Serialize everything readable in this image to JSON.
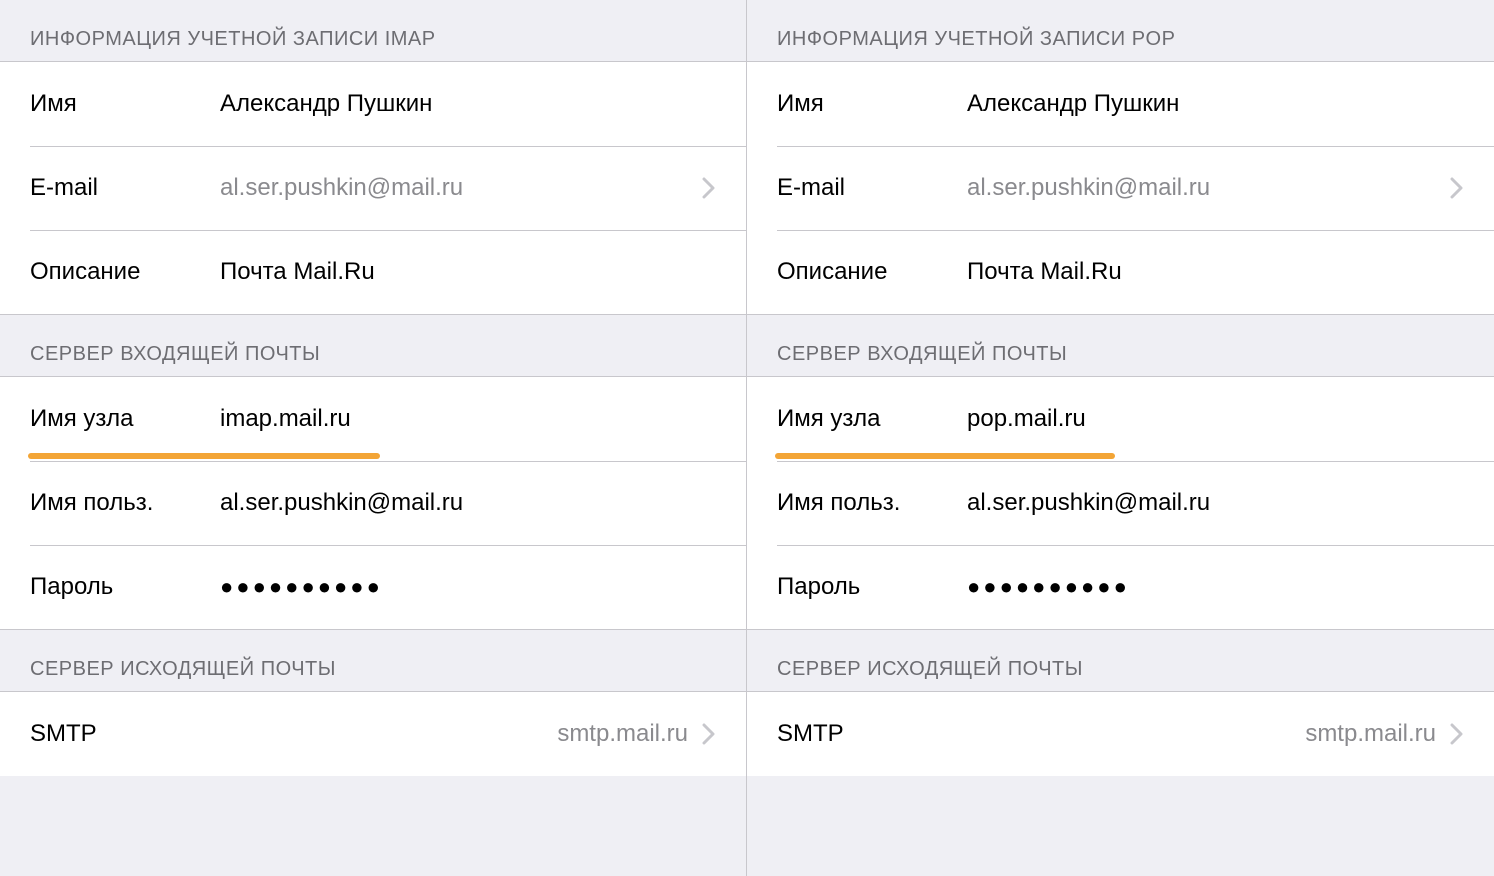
{
  "left": {
    "account_header": "ИНФОРМАЦИЯ УЧЕТНОЙ ЗАПИСИ IMAP",
    "rows": {
      "name_label": "Имя",
      "name_value": "Александр Пушкин",
      "email_label": "E-mail",
      "email_value": "al.ser.pushkin@mail.ru",
      "desc_label": "Описание",
      "desc_value": "Почта Mail.Ru"
    },
    "incoming_header": "СЕРВЕР ВХОДЯЩЕЙ ПОЧТЫ",
    "incoming": {
      "host_label": "Имя узла",
      "host_value": "imap.mail.ru",
      "user_label": "Имя польз.",
      "user_value": "al.ser.pushkin@mail.ru",
      "pass_label": "Пароль",
      "pass_value": "●●●●●●●●●●"
    },
    "outgoing_header": "СЕРВЕР ИСХОДЯЩЕЙ ПОЧТЫ",
    "outgoing": {
      "smtp_label": "SMTP",
      "smtp_value": "smtp.mail.ru"
    },
    "underline_width": 352
  },
  "right": {
    "account_header": "ИНФОРМАЦИЯ УЧЕТНОЙ ЗАПИСИ POP",
    "rows": {
      "name_label": "Имя",
      "name_value": "Александр Пушкин",
      "email_label": "E-mail",
      "email_value": "al.ser.pushkin@mail.ru",
      "desc_label": "Описание",
      "desc_value": "Почта Mail.Ru"
    },
    "incoming_header": "СЕРВЕР ВХОДЯЩЕЙ ПОЧТЫ",
    "incoming": {
      "host_label": "Имя узла",
      "host_value": "pop.mail.ru",
      "user_label": "Имя польз.",
      "user_value": "al.ser.pushkin@mail.ru",
      "pass_label": "Пароль",
      "pass_value": "●●●●●●●●●●"
    },
    "outgoing_header": "СЕРВЕР ИСХОДЯЩЕЙ ПОЧТЫ",
    "outgoing": {
      "smtp_label": "SMTP",
      "smtp_value": "smtp.mail.ru"
    },
    "underline_width": 340
  }
}
